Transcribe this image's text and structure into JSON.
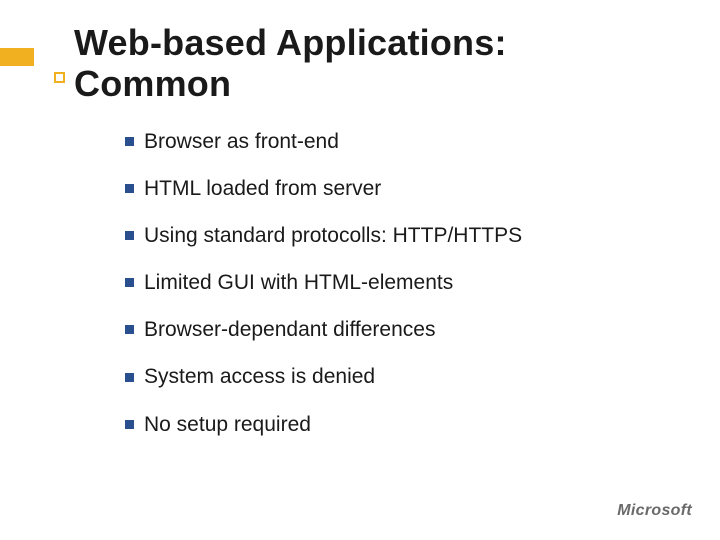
{
  "title_line1": "Web-based Applications:",
  "title_line2": "Common",
  "bullets": [
    "Browser as front-end",
    "HTML loaded from server",
    "Using standard protocolls: HTTP/HTTPS",
    "Limited GUI with HTML-elements",
    "Browser-dependant differences",
    "System access is denied",
    "No setup required"
  ],
  "logo_text": "Microsoft"
}
